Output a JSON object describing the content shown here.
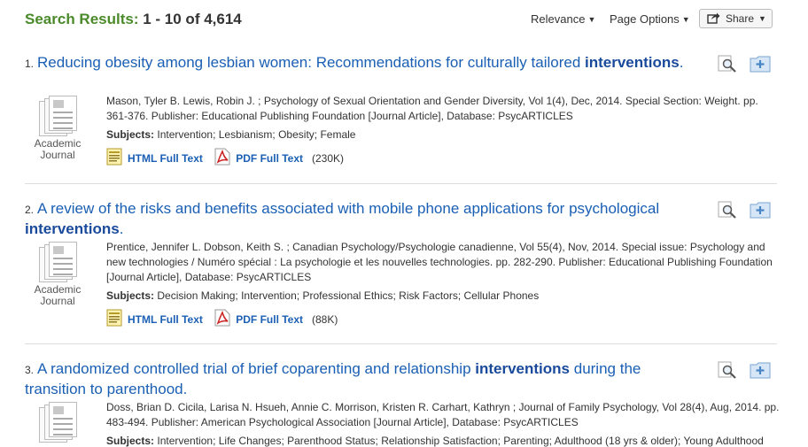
{
  "header": {
    "search_results_label": "Search Results:",
    "range_text": "1 - 10 of 4,614",
    "relevance_label": "Relevance",
    "page_options_label": "Page Options",
    "share_label": "Share"
  },
  "results": [
    {
      "number": "1.",
      "title_parts": [
        "Reducing obesity among lesbian women: Recommendations for culturally tailored ",
        "interventions",
        "."
      ],
      "meta": "Mason, Tyler B. Lewis, Robin J. ; Psychology of Sexual Orientation and Gender Diversity, Vol 1(4), Dec, 2014. Special Section: Weight. pp. 361-376. Publisher: Educational Publishing Foundation [Journal Article], Database: PsycARTICLES",
      "subjects_label": "Subjects:",
      "subjects": "Intervention; Lesbianism; Obesity; Female",
      "type": "Academic Journal",
      "html_label": "HTML Full Text",
      "pdf_label": "PDF Full Text",
      "pdf_size": "(230K)"
    },
    {
      "number": "2.",
      "title_parts": [
        "A review of the risks and benefits associated with mobile phone applications for psychological ",
        "interventions",
        "."
      ],
      "meta": "Prentice, Jennifer L. Dobson, Keith S. ; Canadian Psychology/Psychologie canadienne, Vol 55(4), Nov, 2014. Special issue: Psychology and new technologies / Numéro spécial : La psychologie et les nouvelles technologies. pp. 282-290. Publisher: Educational Publishing Foundation [Journal Article], Database: PsycARTICLES",
      "subjects_label": "Subjects:",
      "subjects": "Decision Making; Intervention; Professional Ethics; Risk Factors; Cellular Phones",
      "type": "Academic Journal",
      "html_label": "HTML Full Text",
      "pdf_label": "PDF Full Text",
      "pdf_size": "(88K)"
    },
    {
      "number": "3.",
      "title_parts": [
        "A randomized controlled trial of brief coparenting and relationship ",
        "interventions",
        " during the transition to parenthood."
      ],
      "meta": "Doss, Brian D. Cicila, Larisa N. Hsueh, Annie C. Morrison, Kristen R. Carhart, Kathryn ; Journal of Family Psychology, Vol 28(4), Aug, 2014. pp. 483-494. Publisher: American Psychological Association [Journal Article], Database: PsycARTICLES",
      "subjects_label": "Subjects:",
      "subjects": "Intervention; Life Changes; Parenthood Status; Relationship Satisfaction; Parenting; Adulthood (18 yrs & older); Young Adulthood"
    }
  ],
  "icons": {
    "preview": "magnifier-icon",
    "add_to_folder": "add-to-folder-icon",
    "html": "html-fulltext-icon",
    "pdf": "pdf-icon",
    "share": "share-arrow-icon"
  },
  "colors": {
    "heading_green": "#4a8a2a",
    "link_blue": "#1a5fb4",
    "pdf_red": "#cc2222"
  }
}
